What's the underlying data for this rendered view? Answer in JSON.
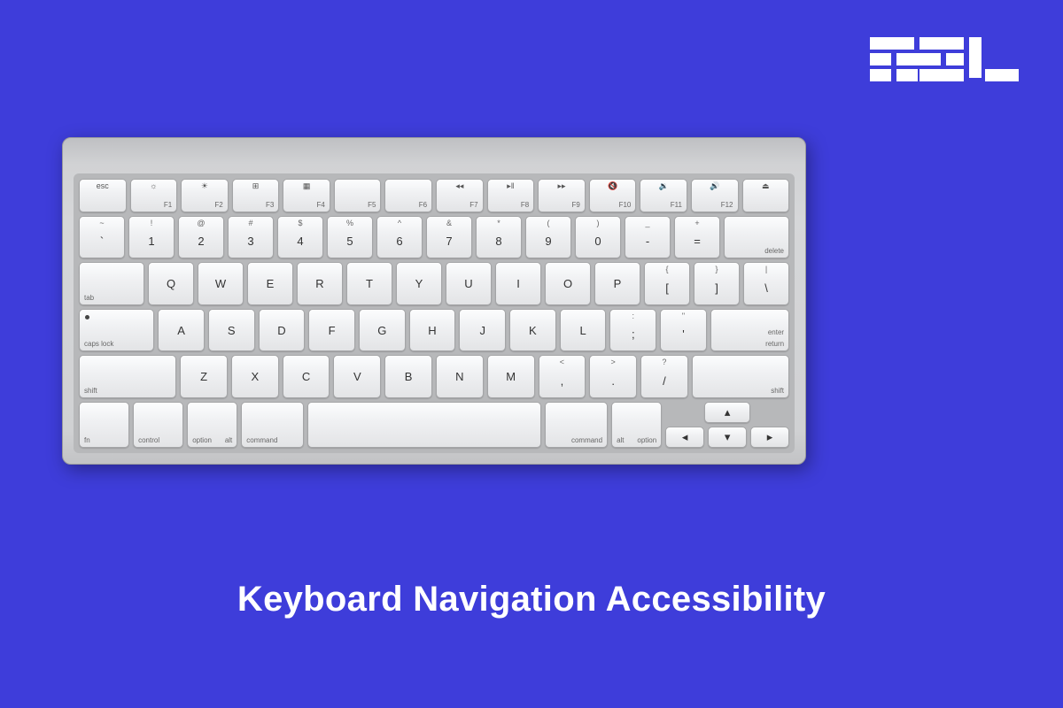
{
  "title": "Keyboard Navigation Accessibility",
  "logo_alt": "AEL",
  "rows": {
    "fn": [
      {
        "main": "esc",
        "sub": ""
      },
      {
        "main": "☼",
        "sub": "F1"
      },
      {
        "main": "☀",
        "sub": "F2"
      },
      {
        "main": "⊞",
        "sub": "F3"
      },
      {
        "main": "▦",
        "sub": "F4"
      },
      {
        "main": "",
        "sub": "F5"
      },
      {
        "main": "",
        "sub": "F6"
      },
      {
        "main": "◂◂",
        "sub": "F7"
      },
      {
        "main": "▸‖",
        "sub": "F8"
      },
      {
        "main": "▸▸",
        "sub": "F9"
      },
      {
        "main": "🔇",
        "sub": "F10"
      },
      {
        "main": "🔉",
        "sub": "F11"
      },
      {
        "main": "🔊",
        "sub": "F12"
      },
      {
        "main": "⏏",
        "sub": ""
      }
    ],
    "num": [
      {
        "top": "~",
        "bot": "`"
      },
      {
        "top": "!",
        "bot": "1"
      },
      {
        "top": "@",
        "bot": "2"
      },
      {
        "top": "#",
        "bot": "3"
      },
      {
        "top": "$",
        "bot": "4"
      },
      {
        "top": "%",
        "bot": "5"
      },
      {
        "top": "^",
        "bot": "6"
      },
      {
        "top": "&",
        "bot": "7"
      },
      {
        "top": "*",
        "bot": "8"
      },
      {
        "top": "(",
        "bot": "9"
      },
      {
        "top": ")",
        "bot": "0"
      },
      {
        "top": "_",
        "bot": "-"
      },
      {
        "top": "+",
        "bot": "="
      },
      {
        "label": "delete"
      }
    ],
    "q": {
      "lead": "tab",
      "keys": [
        "Q",
        "W",
        "E",
        "R",
        "T",
        "Y",
        "U",
        "I",
        "O",
        "P"
      ],
      "tail": [
        {
          "top": "{",
          "bot": "["
        },
        {
          "top": "}",
          "bot": "]"
        },
        {
          "top": "|",
          "bot": "\\"
        }
      ]
    },
    "a": {
      "lead": "caps lock",
      "keys": [
        "A",
        "S",
        "D",
        "F",
        "G",
        "H",
        "J",
        "K",
        "L"
      ],
      "tail": [
        {
          "top": ":",
          "bot": ";"
        },
        {
          "top": "\"",
          "bot": "'"
        }
      ],
      "ret_top": "enter",
      "ret_bot": "return"
    },
    "z": {
      "lead": "shift",
      "keys": [
        "Z",
        "X",
        "C",
        "V",
        "B",
        "N",
        "M"
      ],
      "tail": [
        {
          "top": "<",
          "bot": ","
        },
        {
          "top": ">",
          "bot": "."
        },
        {
          "top": "?",
          "bot": "/"
        }
      ],
      "trail": "shift"
    },
    "mod": {
      "fn": "fn",
      "ctrl": "control",
      "alt": "alt",
      "opt": "option",
      "cmd": "command",
      "arrows": {
        "up": "▴",
        "left": "◂",
        "down": "▾",
        "right": "▸"
      }
    }
  }
}
